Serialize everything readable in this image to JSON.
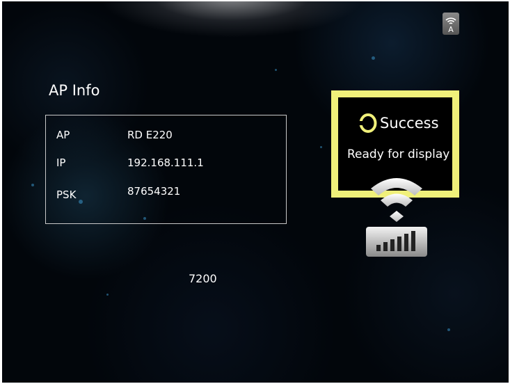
{
  "ap_info": {
    "title": "AP Info",
    "rows": [
      {
        "label": "AP",
        "value": "RD E220"
      },
      {
        "label": "IP",
        "value": "192.168.111.1"
      },
      {
        "label": "PSK",
        "value": "87654321"
      }
    ]
  },
  "counter": "7200",
  "status": {
    "title": "Success",
    "message": "Ready for display"
  },
  "top_indicator": {
    "icon": "wifi-auto-icon",
    "letter": "A"
  },
  "colors": {
    "status_border": "#f0f07a",
    "background": "#02060b",
    "text": "#ffffff"
  }
}
